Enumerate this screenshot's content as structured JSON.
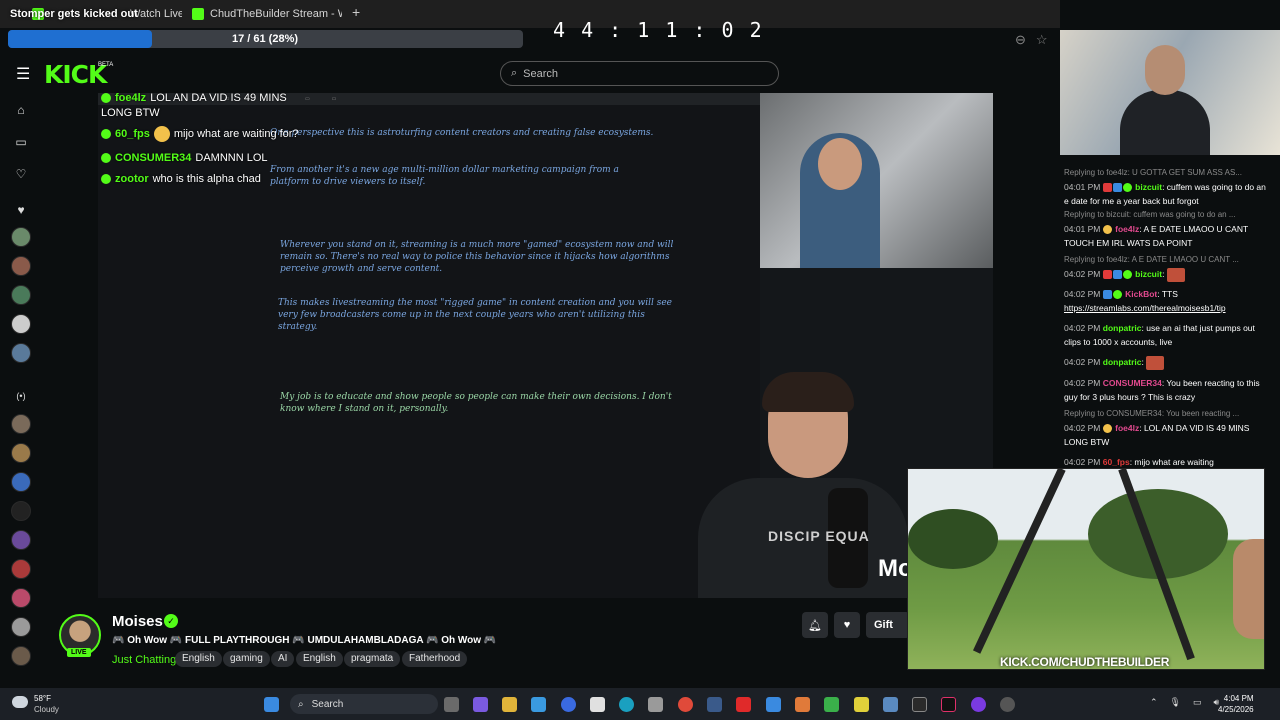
{
  "browser": {
    "overlay_title": "Stomper gets kicked out",
    "tab1_label": "Watch Live o",
    "tab2_label": "ChudTheBuilder Stream - Wat",
    "new_tab": "+",
    "close": "✕"
  },
  "progress": {
    "text": "17 / 61 (28%)",
    "fraction": 0.28
  },
  "timer": "4 4 : 1 1 : 0 2",
  "header": {
    "logo": "KICK",
    "logo_beta": "BETA",
    "search_placeholder": "Search"
  },
  "video_chat": [
    {
      "user": "foe4lz",
      "message": "LOL AN DA VID IS 49 MINS"
    },
    {
      "user": "",
      "message": "LONG BTW"
    },
    {
      "user": "60_fps",
      "message": "mijo what are waiting for?"
    },
    {
      "user": "CONSUMER34",
      "message": "DAMNNN LOL"
    },
    {
      "user": "zootor",
      "message": "who is this alpha chad"
    }
  ],
  "drawing": {
    "p1": "One perspective this is astroturfing content creators and creating false ecosystems.",
    "p2": "From another it's a new age multi-million dollar marketing campaign from a platform to drive viewers to itself.",
    "p3": "Wherever you stand on it, streaming is a much more \"gamed\" ecosystem now and will remain so. There's no real way to police this behavior since it hijacks how algorithms perceive growth and serve content.",
    "p4": "This makes livestreaming the most \"rigged game\" in content creation and you will see very few broadcasters come up in the next couple years who aren't utilizing this strategy.",
    "p5": "My job is to educate and show people so people can make their own decisions. I don't know where I stand on it, personally.",
    "shirt_text": "DISCIP EQUA",
    "m_letter": "Mo"
  },
  "channel": {
    "name": "Moises",
    "live": "LIVE",
    "title": "🎮 Oh Wow 🎮 FULL PLAYTHROUGH 🎮 UMDULAHAMBLADAGA 🎮 Oh Wow 🎮",
    "category": "Just Chatting",
    "tags": [
      "English",
      "gaming",
      "AI",
      "English",
      "pragmata",
      "Fatherhood"
    ],
    "gift_label": "Gift"
  },
  "chat": [
    {
      "reply": "Replying to foe4lz: U GOTTA GET SUM ASS AS...",
      "time": "04:01 PM",
      "user": "bizcuit",
      "color": "green",
      "msg": ": cuffem was going to do an e date for me a year back but forgot"
    },
    {
      "reply": "Replying to bizcuit: cuffem was going to do an ...",
      "time": "04:01 PM",
      "user": "foe4lz",
      "color": "pink",
      "msg": ": A E DATE LMAOO U CANT TOUCH EM IRL WATS DA POINT"
    },
    {
      "reply": "Replying to foe4lz: A E DATE LMAOO U CANT ...",
      "time": "04:02 PM",
      "user": "bizcuit",
      "color": "green",
      "msg": ":"
    },
    {
      "reply": "",
      "time": "04:02 PM",
      "user": "KickBot",
      "color": "pink",
      "msg": ": TTS"
    },
    {
      "reply": "",
      "time": "",
      "user": "",
      "color": "",
      "msg": "https://streamlabs.com/therealmoisesb1/tip"
    },
    {
      "reply": "",
      "time": "04:02 PM",
      "user": "donpatric",
      "color": "green",
      "msg": ": use an ai that just pumps out clips to 1000 x accounts, live"
    },
    {
      "reply": "",
      "time": "04:02 PM",
      "user": "donpatric",
      "color": "green",
      "msg": ":"
    },
    {
      "reply": "",
      "time": "04:02 PM",
      "user": "CONSUMER34",
      "color": "pink",
      "msg": ": You been reacting to this guy for 3 plus hours ? This is crazy"
    },
    {
      "reply": "Replying to CONSUMER34: You been reacting ...",
      "time": "04:02 PM",
      "user": "foe4lz",
      "color": "pink",
      "msg": ": LOL AN DA VID IS 49 MINS LONG BTW"
    },
    {
      "reply": "",
      "time": "04:02 PM",
      "user": "60_fps",
      "color": "red",
      "msg": ": mijo what are waiting"
    }
  ],
  "park_cam": {
    "url": "KICK.COM/CHUDTHEBUILDER"
  },
  "taskbar": {
    "temp": "58°F",
    "weather": "Cloudy",
    "search": "Search",
    "time": "4:04 PM",
    "date": "4/25/2026"
  },
  "colors": {
    "kick_green": "#53fc18",
    "progress_blue": "#1f6fd1",
    "background": "#0b0e0f"
  }
}
